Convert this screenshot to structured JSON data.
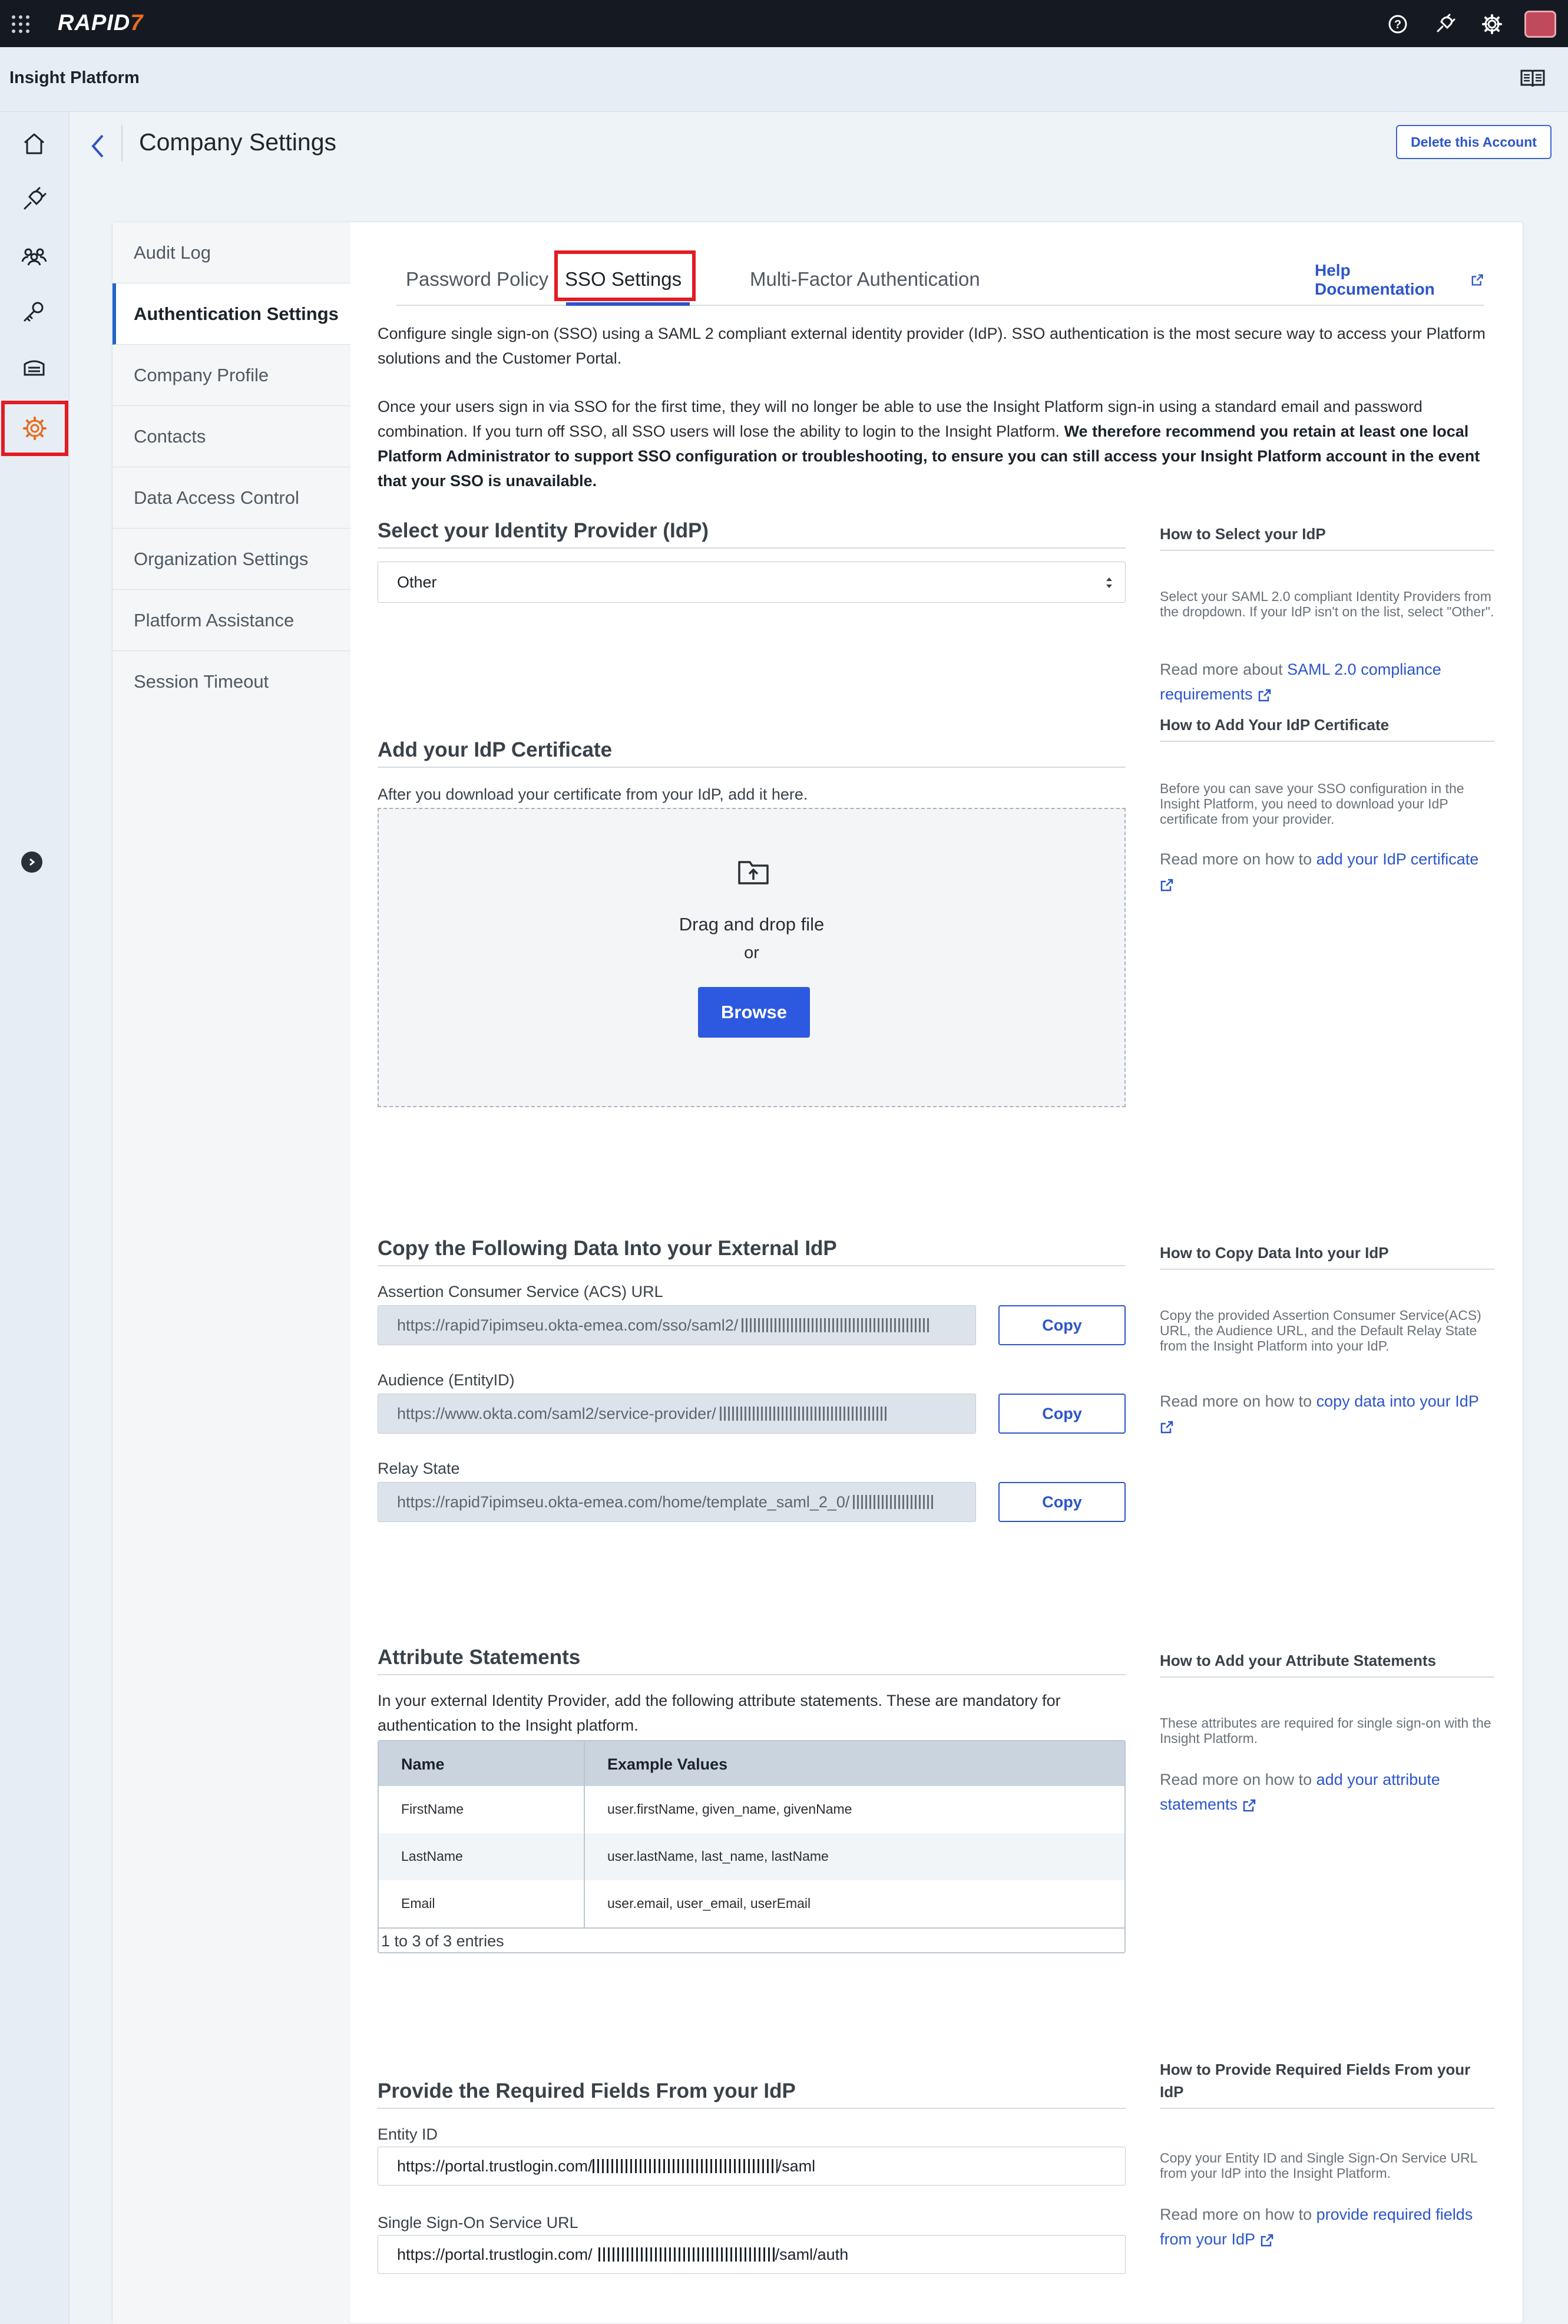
{
  "topbar": {
    "logo": "RAPID",
    "logo_seven": "7"
  },
  "platform": {
    "name": "Insight Platform"
  },
  "header": {
    "title": "Company Settings",
    "delete_label": "Delete this Account"
  },
  "sidemenu": [
    "Audit Log",
    "Authentication Settings",
    "Company Profile",
    "Contacts",
    "Data Access Control",
    "Organization Settings",
    "Platform Assistance",
    "Session Timeout"
  ],
  "tabs": {
    "password": "Password Policy",
    "sso": "SSO Settings",
    "mfa": "Multi-Factor Authentication",
    "help": "Help Documentation"
  },
  "intro": {
    "p1": "Configure single sign-on (SSO) using a SAML 2 compliant external identity provider (IdP). SSO authentication is the most secure way to access your Platform solutions and the Customer Portal.",
    "p2_normal": "Once your users sign in via SSO for the first time, they will no longer be able to use the Insight Platform sign-in using a standard email and password combination. If you turn off SSO, all SSO users will lose the ability to login to the Insight Platform. ",
    "p2_bold": "We therefore recommend you retain at least one local Platform Administrator to support SSO configuration or troubleshooting, to ensure you can still access your Insight Platform account in the event that your SSO is unavailable."
  },
  "idp": {
    "heading": "Select your Identity Provider (IdP)",
    "selected": "Other",
    "side_heading": "How to Select your IdP",
    "side_text": "Select your SAML 2.0 compliant Identity Providers from the dropdown. If your IdP isn't on the list, select \"Other\".",
    "side_read": "Read more about ",
    "side_link": "SAML 2.0 compliance requirements"
  },
  "cert": {
    "heading": "Add your IdP Certificate",
    "instruction": "After you download your certificate from your IdP, add it here.",
    "drag": "Drag and drop file",
    "or": "or",
    "browse": "Browse",
    "side_heading": "How to Add Your IdP Certificate",
    "side_text": "Before you can save your SSO configuration in the Insight Platform, you need to download your IdP certificate from your provider.",
    "side_read": "Read more on how to ",
    "side_link": "add your IdP certificate"
  },
  "copy": {
    "heading": "Copy the Following Data Into your External IdP",
    "acs_label": "Assertion Consumer Service (ACS) URL",
    "acs_value": "https://rapid7ipimseu.okta-emea.com/sso/saml2/",
    "aud_label": "Audience (EntityID)",
    "aud_value": "https://www.okta.com/saml2/service-provider/",
    "relay_label": "Relay State",
    "relay_value": "https://rapid7ipimseu.okta-emea.com/home/template_saml_2_0/",
    "copy_label": "Copy",
    "side_heading": "How to Copy Data Into your IdP",
    "side_text": "Copy the provided Assertion Consumer Service(ACS) URL, the Audience URL, and the Default Relay State from the Insight Platform into your IdP.",
    "side_read": "Read more on how to ",
    "side_link": "copy data into your IdP"
  },
  "attributes": {
    "heading": "Attribute Statements",
    "description": "In your external Identity Provider, add the following attribute statements. These are mandatory for authentication to the Insight platform.",
    "col_name": "Name",
    "col_values": "Example Values",
    "rows": [
      {
        "name": "FirstName",
        "values": "user.firstName, given_name, givenName"
      },
      {
        "name": "LastName",
        "values": "user.lastName, last_name, lastName"
      },
      {
        "name": "Email",
        "values": "user.email, user_email, userEmail"
      }
    ],
    "footer": "1 to 3 of 3 entries",
    "side_heading": "How to Add your Attribute Statements",
    "side_text": "These attributes are required for single sign-on with the Insight Platform.",
    "side_read": "Read more on how to ",
    "side_link": "add your attribute statements"
  },
  "required": {
    "heading": "Provide the Required Fields From your IdP",
    "entity_label": "Entity ID",
    "entity_prefix": "https://portal.trustlogin.com/",
    "entity_suffix": "/saml",
    "sso_label": "Single Sign-On Service URL",
    "sso_prefix": "https://portal.trustlogin.com/",
    "sso_suffix": "/saml/auth",
    "side_heading": "How to Provide Required Fields From your IdP",
    "side_text": "Copy your Entity ID and Single Sign-On Service URL from your IdP into the Insight Platform.",
    "side_read": "Read more on how to ",
    "side_link": "provide required fields from your IdP"
  },
  "colors": {
    "accent": "#2c55c9",
    "highlight": "#e21b24",
    "topbar": "#151a22",
    "brand_orange": "#e96b1f"
  }
}
